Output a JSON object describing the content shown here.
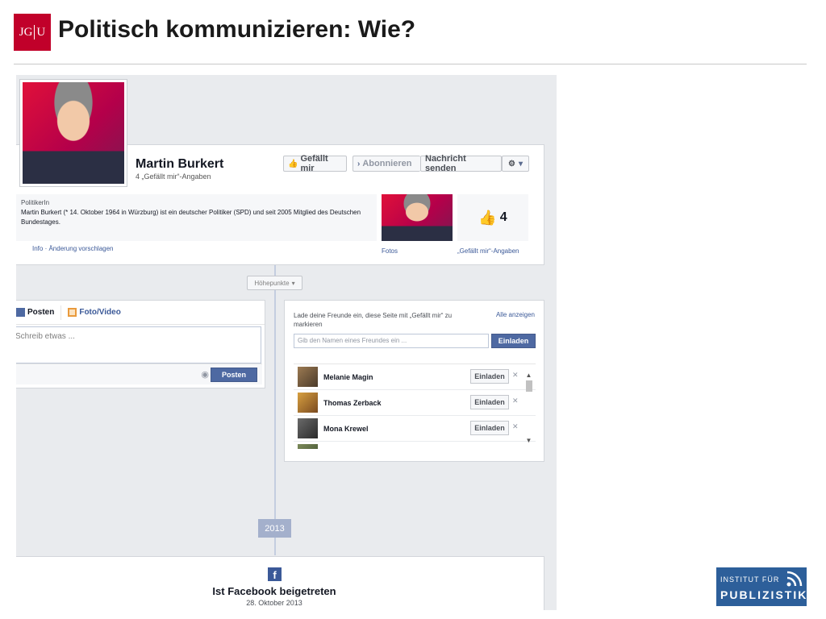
{
  "slide": {
    "logo_text_left": "JG",
    "logo_text_right": "U",
    "title": "Politisch kommunizieren: Wie?"
  },
  "profile": {
    "name": "Martin Burkert",
    "likes_line": "4 „Gefällt mir“-Angaben",
    "buttons": {
      "like": "Gefällt mir",
      "subscribe": "Abonnieren",
      "message": "Nachricht senden",
      "gear_icon": "gear-icon"
    },
    "about": {
      "category": "PolitikerIn",
      "text": "Martin Burkert (* 14. Oktober 1964 in Würzburg) ist ein deutscher Politiker (SPD) und seit 2005 Mitglied des Deutschen Bundestages."
    },
    "links": "Info · Änderung vorschlagen",
    "photos_label": "Fotos",
    "likes_box_count": "4",
    "likes_box_label": "„Gefällt mir“-Angaben"
  },
  "timeline": {
    "highlights": "Höhepunkte",
    "year": "2013"
  },
  "composer": {
    "tab_post": "Posten",
    "tab_photo": "Foto/Video",
    "placeholder": "Schreib etwas ...",
    "post_button": "Posten"
  },
  "invite": {
    "header": "Lade deine Freunde ein, diese Seite mit „Gefällt mir“ zu markieren",
    "show_all": "Alle anzeigen",
    "search_placeholder": "Gib den Namen eines Freundes ein ...",
    "invite_button": "Einladen",
    "friends": [
      {
        "name": "Melanie Magin",
        "button": "Einladen"
      },
      {
        "name": "Thomas Zerback",
        "button": "Einladen"
      },
      {
        "name": "Mona Krewel",
        "button": "Einladen"
      }
    ]
  },
  "joined": {
    "title": "Ist Facebook beigetreten",
    "date": "28. Oktober 2013"
  },
  "ifp": {
    "line1": "INSTITUT FÜR",
    "line2": "PUBLIZISTIK"
  },
  "colors": {
    "fb_blue": "#3b5998",
    "button_blue": "#4e69a2",
    "jgu_red": "#c1002a",
    "ifp_blue": "#2d5f9a"
  }
}
